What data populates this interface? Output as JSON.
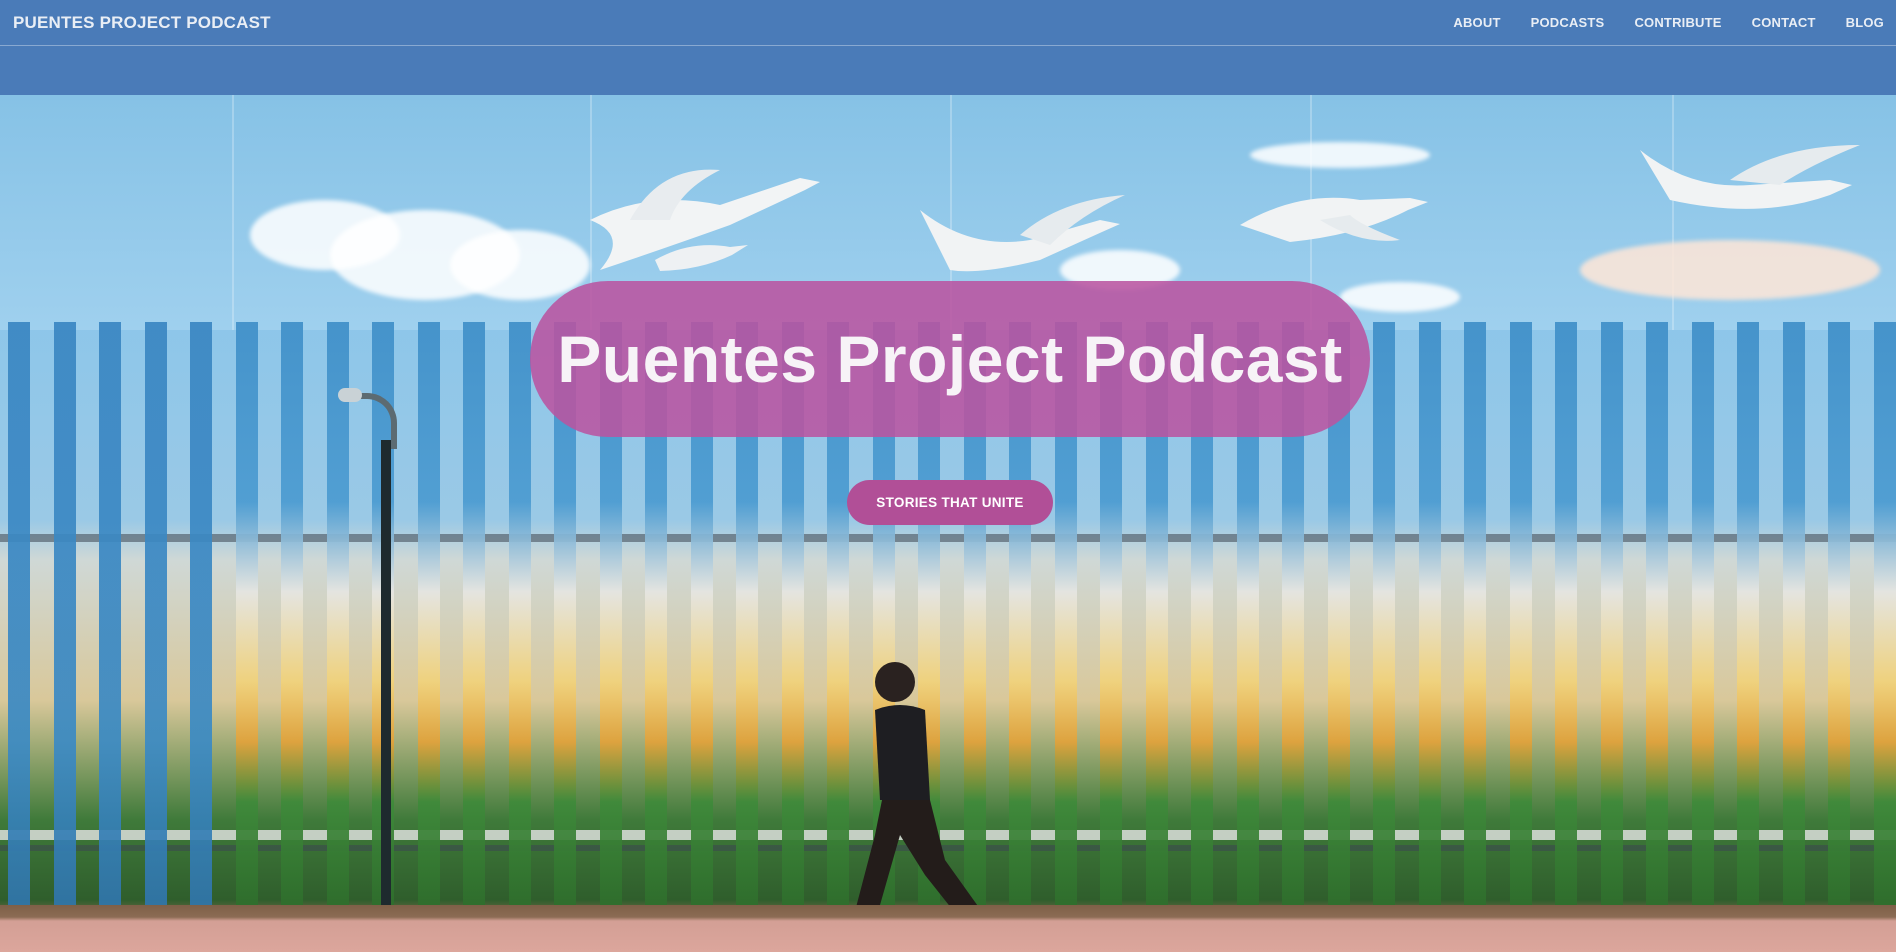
{
  "navbar": {
    "brand": "PUENTES PROJECT PODCAST",
    "links": [
      {
        "label": "ABOUT"
      },
      {
        "label": "PODCASTS"
      },
      {
        "label": "CONTRIBUTE"
      },
      {
        "label": "CONTACT"
      },
      {
        "label": "BLOG"
      }
    ]
  },
  "hero": {
    "title": "Puentes Project Podcast",
    "cta_label": "STORIES THAT UNITE",
    "background_image": "painted-border-fence-mural-with-birds-and-person-walking"
  },
  "colors": {
    "navbar_bg": "#4a7bb8",
    "title_pill": "#ba54a0",
    "cta_bg": "#b14f97",
    "nav_text": "#e9eef5"
  }
}
